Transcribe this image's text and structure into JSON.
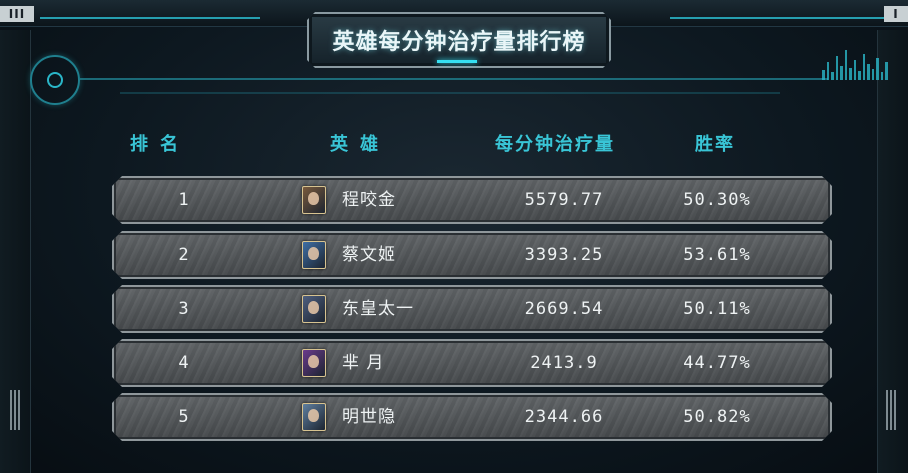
{
  "header": {
    "title": "英雄每分钟治疗量排行榜",
    "left_badge": "III",
    "right_badge": "I"
  },
  "columns": {
    "rank": "排名",
    "hero": "英雄",
    "heal": "每分钟治疗量",
    "win_rate": "胜率"
  },
  "rows": [
    {
      "rank": "1",
      "hero": "程咬金",
      "heal": "5579.77",
      "win_rate": "50.30%",
      "avatar": "cheng-yaojin-portrait",
      "avatar_color": "#7a5a3c"
    },
    {
      "rank": "2",
      "hero": "蔡文姬",
      "heal": "3393.25",
      "win_rate": "53.61%",
      "avatar": "cai-wenji-portrait",
      "avatar_color": "#3f6fa6"
    },
    {
      "rank": "3",
      "hero": "东皇太一",
      "heal": "2669.54",
      "win_rate": "50.11%",
      "avatar": "donghuang-taiyi-portrait",
      "avatar_color": "#4e5f80"
    },
    {
      "rank": "4",
      "hero": "芈 月",
      "heal": "2413.9",
      "win_rate": "44.77%",
      "avatar": "mi-yue-portrait",
      "avatar_color": "#6a3a8c"
    },
    {
      "rank": "5",
      "hero": "明世隐",
      "heal": "2344.66",
      "win_rate": "50.82%",
      "avatar": "ming-shiyin-portrait",
      "avatar_color": "#5f7fa0"
    }
  ],
  "colors": {
    "accent": "#2ab6c8",
    "header_text": "#39c5d6",
    "row_text": "#eef2f3"
  }
}
